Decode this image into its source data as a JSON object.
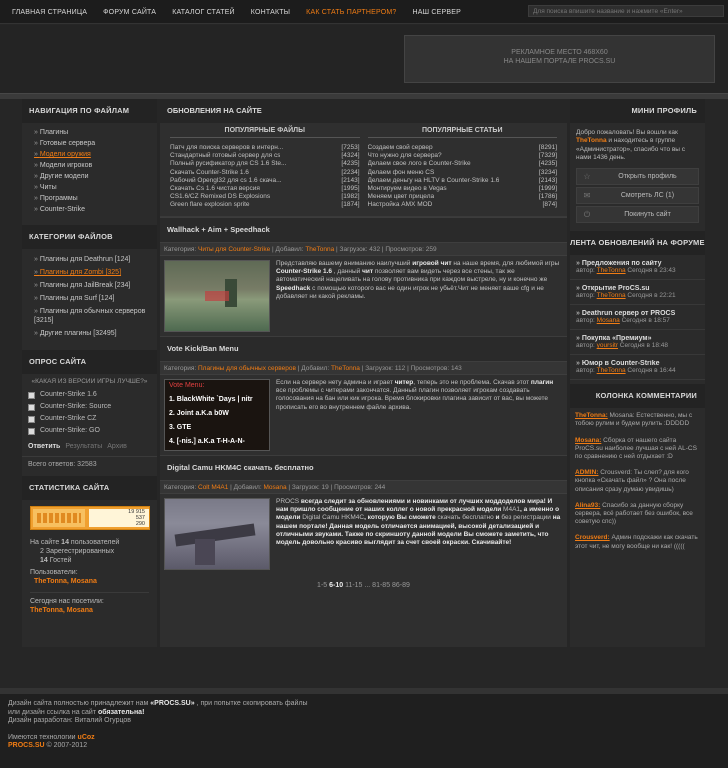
{
  "topnav": {
    "items": [
      "ГЛАВНАЯ СТРАНИЦА",
      "ФОРУМ САЙТА",
      "КАТАЛОГ СТАТЕЙ",
      "КОНТАКТЫ",
      "КАК СТАТЬ ПАРТНЕРОМ?",
      "НАШ СЕРВЕР"
    ],
    "search_placeholder": "Для поиска впишите название и нажмите «Enter»"
  },
  "ad": {
    "line1": "РЕКЛАМНОЕ МЕСТО 468Х60",
    "line2": "НА НАШЕМ ПОРТАЛЕ PROCS.SU"
  },
  "left": {
    "nav_title": "НАВИГАЦИЯ ПО ФАЙЛАМ",
    "nav": [
      "Плагины",
      "Готовые сервера",
      "Модели оружия",
      "Модели игроков",
      "Другие модели",
      "Читы",
      "Программы",
      "Counter-Strike"
    ],
    "cat_title": "КАТЕГОРИИ ФАЙЛОВ",
    "cats": [
      "Плагины для Deathrun [124]",
      "Плагины для Zombi [325]",
      "Плагины для JailBreak [234]",
      "Плагины для Surf [124]",
      "Плагины для обычных серверов [3215]",
      "Другие плагины [32495]"
    ],
    "poll_title": "ОПРОС САЙТА",
    "poll_q": "«КАКАЯ ИЗ ВЕРСИИ ИГРЫ ЛУЧШЕ?»",
    "poll_opts": [
      "Counter-Strike 1.6",
      "Counter-Strike: Source",
      "Counter-Strike CZ",
      "Counter-Strike: GO"
    ],
    "poll_vote": "Ответить",
    "poll_results": "Результаты",
    "poll_archive": "Архив",
    "poll_total": "Всего ответов: 32583",
    "stat_title": "СТАТИСТИКА САЙТА",
    "counter": {
      "n1": "19 915",
      "n2": "537",
      "n3": "290"
    },
    "online_prefix": "На сайте ",
    "online_count": "14",
    "online_suffix": " пользователей",
    "reg": "2 Зарегестрированных",
    "guests_count": "14",
    "guests_suffix": " Гостей",
    "users_label": "Пользователи:",
    "users": "TheTonna, Mosana",
    "today_label": "Сегодня нас посетили:",
    "today": "TheTonna, Mosana"
  },
  "center": {
    "updates_title": "ОБНОВЛЕНИЯ НА САЙТЕ",
    "files_title": "ПОПУЛЯРНЫЕ ФАЙЛЫ",
    "articles_title": "ПОПУЛЯРНЫЕ СТАТЬИ",
    "files": [
      {
        "t": "Патч для поиска серверов в интерн...",
        "n": "[7253]"
      },
      {
        "t": "Стандартный готовый сервер для cs",
        "n": "[4324]"
      },
      {
        "t": "Полный русификатор для CS 1.6 Ste...",
        "n": "[4235]"
      },
      {
        "t": "Скачать Counter-Strike 1.6",
        "n": "[2234]"
      },
      {
        "t": "Рабочий Opengl32 для cs 1.6 скача...",
        "n": "[2143]"
      },
      {
        "t": "Скачать Cs 1.6 чистая версия",
        "n": "[1995]"
      },
      {
        "t": "CS1.6/CZ Remixed DS Explosions",
        "n": "[1982]"
      },
      {
        "t": "Green flare explosion sprite",
        "n": "[1874]"
      }
    ],
    "articles": [
      {
        "t": "Создаем свой сервер",
        "n": "[8291]"
      },
      {
        "t": "Что нужно для сервера?",
        "n": "[7329]"
      },
      {
        "t": "Делаем свое лого в Counter-Strike",
        "n": "[4235]"
      },
      {
        "t": "Делаем фон меню CS",
        "n": "[3234]"
      },
      {
        "t": "Делаем деньгу на HLTV в Counter-Strike 1.6",
        "n": "[2143]"
      },
      {
        "t": "Монтируем видео в Vegas",
        "n": "[1999]"
      },
      {
        "t": "Меняем цвет прицела",
        "n": "[1786]"
      },
      {
        "t": "Настройка AMX MOD",
        "n": "[874]"
      }
    ],
    "posts": [
      {
        "title": "Wallhack + Aim + Speedhack",
        "cat_label": "Категория: ",
        "cat": "Читы для Counter-Strike",
        "add_label": " | Добавил: ",
        "author": "TheTonna",
        "rest": " | Загрузок: 432 | Просмотров: 259",
        "text": [
          "Представляю вашему вниманию наилучший ",
          "игровой чит",
          " на наше время, для любимой игры ",
          "Counter-Strike 1.6",
          " , данный ",
          "чит",
          " позволяет вам видеть через все стены, так же автоматический нацеливать на голову противника при каждом выстреле, ну и конечно же ",
          "Speedhack",
          " с помощью которого вас не один игрок не убьёт.Чит не меняет ваше cfg и не добавляет ни какой рекламы."
        ]
      },
      {
        "title": "Vote Kick/Ban Menu",
        "cat_label": "Категория: ",
        "cat": "Плагины для обычных серверов",
        "add_label": " | Добавил: ",
        "author": "TheTonna",
        "rest": " | Загрузок: 112 | Просмотров: 143",
        "img_title": "Vote Menu:",
        "img_lines": [
          "1. BlackWhite `Days | nitr",
          "2. Joint a.K.a b0W",
          "3. GTE",
          "4. [-nis.] a.K.a T-H-A-N-"
        ],
        "text": [
          "Если на сервере нету админа и играет ",
          "читер",
          ", теперь это не проблема. Скачав этот ",
          "плагин",
          " все проблемы с читерами закончатся. Данный плагин позволяет игрокам создавать голосования на бан или кик игрока. Время блокировки плагина зависит от вас, вы можете прописать его во внутреннем файле архива."
        ]
      },
      {
        "title": "Digital Camu HKM4C скачать бесплатно",
        "cat_label": "Категория: ",
        "cat": "Colt M4A1",
        "add_label": " | Добавил: ",
        "author": "Mosana",
        "rest": " | Загрузок: 19 | Просмотров: 244",
        "text": [
          "PROCS",
          " всегда следит за обновлениями и новинками от лучших моддоделов мира! И нам пришло сообщение от наших коллег о новой прекрасной модели ",
          "M4A1",
          ", а именно о модели ",
          "Digital Camu HKM4C",
          ", которую Вы сможете ",
          "скачать бесплатно",
          " и ",
          "без регистрации",
          " на нашем портале! Данная модель отличается анимацией, высокой детализацией и отличными звуками. Также по скриншоту данной модели Вы сможете заметить, что модель довольно красиво выглядит за счет своей окраски. Скачивайте!"
        ]
      }
    ],
    "pager": {
      "pre": "1-5 ",
      "cur": "6-10",
      "post": " 11-15 ... 81-85 86-89"
    }
  },
  "right": {
    "mini_title": "МИНИ ПРОФИЛЬ",
    "welcome_pre": "Добро пожаловать! Вы вошли как ",
    "user": "TheTonna",
    "welcome_post": " и находитесь в группе «Администратор», спасибо что вы с нами 1436 день.",
    "btn_profile": "Открыть профиль",
    "btn_pm": "Смотреть ЛС (1)",
    "btn_logout": "Покинуть сайт",
    "forum_title": "ЛЕНТА ОБНОВЛЕНИЙ НА ФОРУМЕ",
    "forum": [
      {
        "t": "Предложения по сайту",
        "u": "TheTonna",
        "d": " Сегодня в 23:43"
      },
      {
        "t": "Открытие ProCS.su",
        "u": "TheTonna",
        "d": " Сегодня в 22:21"
      },
      {
        "t": "Deathrun сервер от PROCS",
        "u": "Mosana",
        "d": " Сегодня в 18:57"
      },
      {
        "t": "Покупка «Премиум»",
        "u": "yoursitr",
        "d": " Сегодня в 18:48"
      },
      {
        "t": "Юмор в Counter-Strike",
        "u": "TheTonna",
        "d": " Сегодня в 16:44"
      }
    ],
    "author_label": "автор: ",
    "cmt_title": "КОЛОНКА КОММЕНТАРИИ",
    "comments": [
      {
        "u": "TheTonna:",
        "t": " Mosana: Естественно, мы с тобою рулим и будем рулить :DDDDD"
      },
      {
        "u": "Mosana:",
        "t": " Сборка от нашего сайта ProCS.su наиболее лучшая с ней AL-CS по сравнению с ней отдыхает :D"
      },
      {
        "u": "ADMIN:",
        "t": " Crousverd: Ты слеп? для кого кнопка «Скачать файл» ? Она после описания сразу думаю увидишь)"
      },
      {
        "u": "Alina93:",
        "t": " Спасибо за данную сборку сервера, всё работает без ошибок, все советую спс))"
      },
      {
        "u": "Crousverd:",
        "t": " Админ подскажи как скачать этот чит, не могу вообще ни как! ((((("
      }
    ]
  },
  "footer": {
    "l1_pre": "Дизайн сайта полностью принадлежит нам ",
    "l1_site": "«PROCS.SU»",
    "l1_post": " , при попытке скопировать файлы",
    "l2_pre": "или дизайн ссылка на сайт ",
    "l2_b": "обязательна!",
    "l3": "Дизайн разработан: Виталий Огурцов",
    "l4_pre": "Имеются технологии ",
    "l4_ucoz": "uCoz",
    "l5_site": "PROCS.SU",
    "l5_post": " © 2007-2012"
  }
}
